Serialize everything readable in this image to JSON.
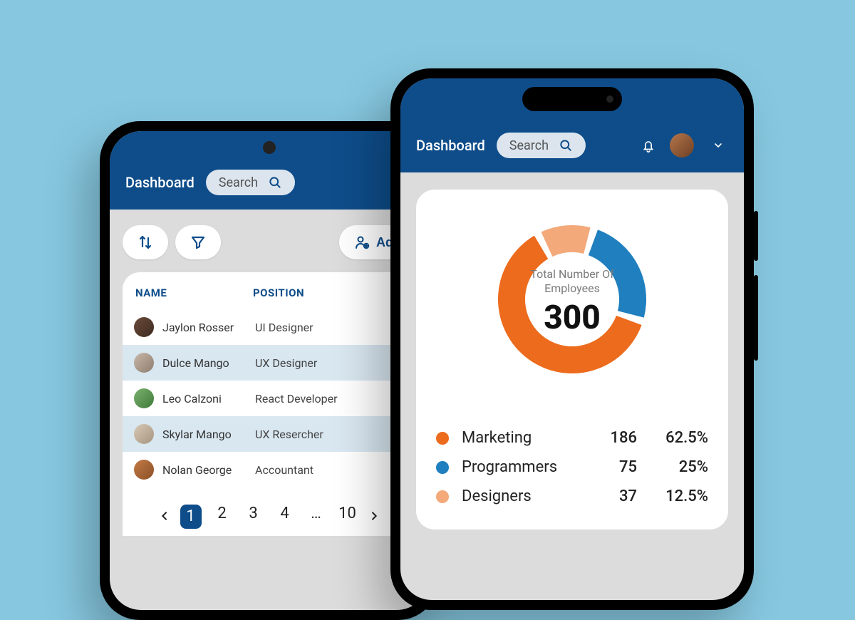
{
  "header": {
    "title": "Dashboard",
    "search_placeholder": "Search"
  },
  "left_screen": {
    "add_label": "Add",
    "columns": {
      "name": "NAME",
      "position": "POSITION"
    },
    "rows": [
      {
        "name": "Jaylon Rosser",
        "position": "UI Designer",
        "highlight": false,
        "avatar": "c1"
      },
      {
        "name": "Dulce Mango",
        "position": "UX Designer",
        "highlight": true,
        "avatar": "c2"
      },
      {
        "name": "Leo Calzoni",
        "position": "React Developer",
        "highlight": false,
        "avatar": "c3"
      },
      {
        "name": "Skylar Mango",
        "position": "UX Resercher",
        "highlight": true,
        "avatar": "c4"
      },
      {
        "name": "Nolan George",
        "position": "Accountant",
        "highlight": false,
        "avatar": "c5"
      }
    ],
    "pagination": {
      "pages": [
        "1",
        "2",
        "3",
        "4",
        "…",
        "10"
      ],
      "current": "1"
    }
  },
  "right_screen": {
    "center_label": "Total Number Of Employees",
    "total": "300",
    "legend": [
      {
        "name": "Marketing",
        "value": "186",
        "percent": "62.5%",
        "color": "#ed6b1d"
      },
      {
        "name": "Programmers",
        "value": "75",
        "percent": "25%",
        "color": "#1f7fbf"
      },
      {
        "name": "Designers",
        "value": "37",
        "percent": "12.5%",
        "color": "#f3a97a"
      }
    ]
  },
  "chart_data": {
    "type": "pie",
    "title": "Total Number Of Employees",
    "total": 300,
    "series": [
      {
        "name": "Marketing",
        "value": 186,
        "percent": 62.5,
        "color": "#ed6b1d"
      },
      {
        "name": "Programmers",
        "value": 75,
        "percent": 25.0,
        "color": "#1f7fbf"
      },
      {
        "name": "Designers",
        "value": 37,
        "percent": 12.5,
        "color": "#f3a97a"
      }
    ],
    "style": "donut"
  }
}
